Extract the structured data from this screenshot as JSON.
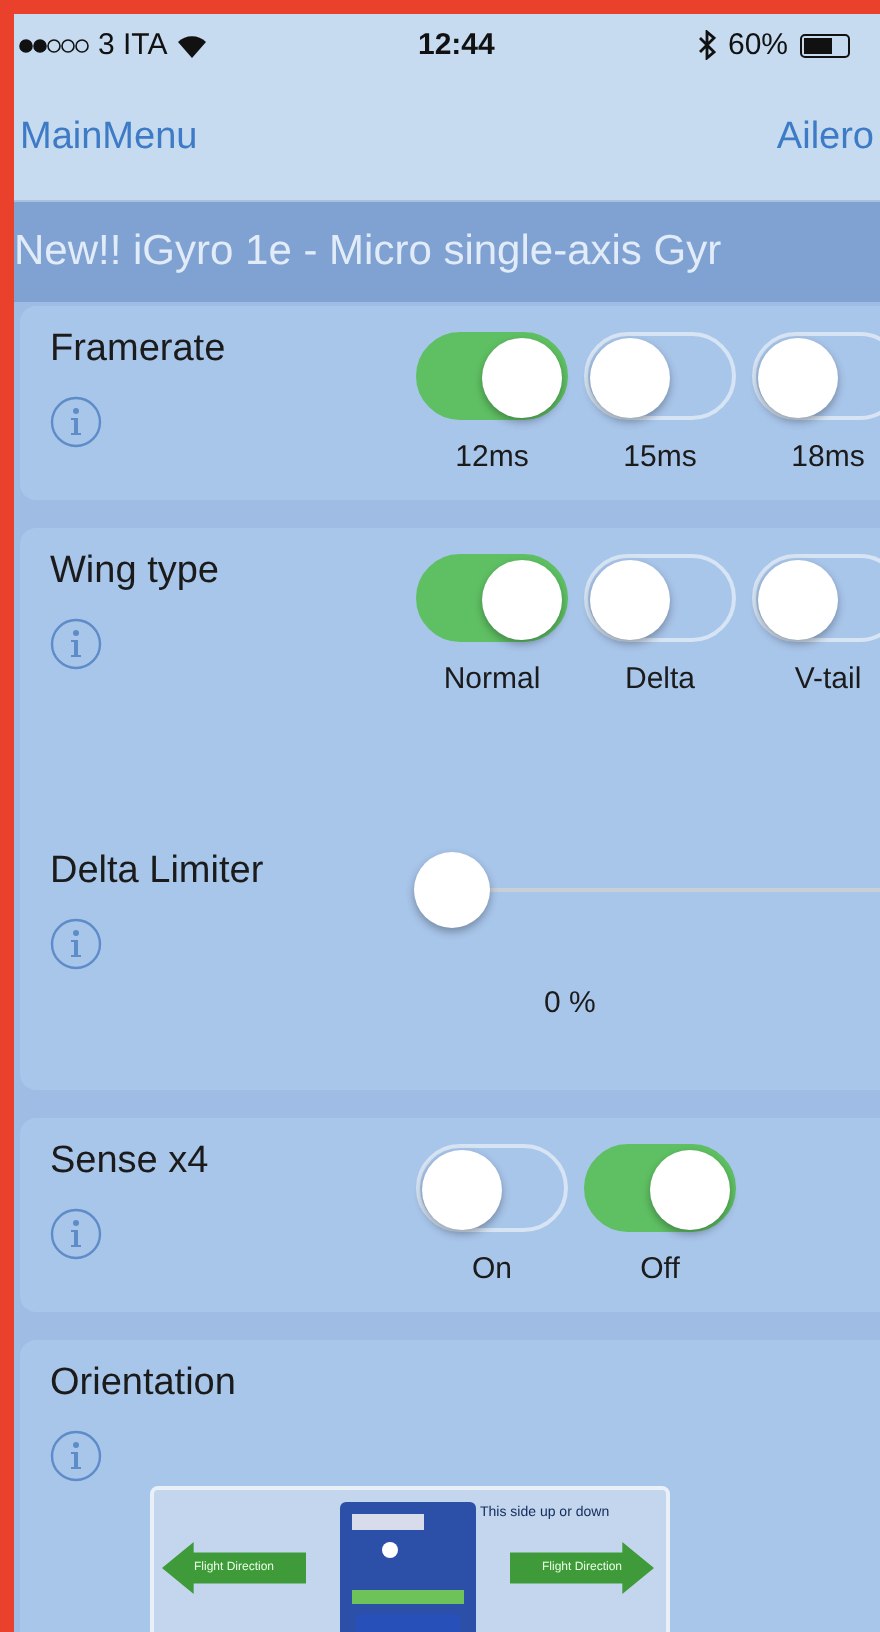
{
  "status_bar": {
    "carrier": "3 ITA",
    "time": "12:44",
    "battery": "60%"
  },
  "nav": {
    "back": "MainMenu",
    "title": "Ailero"
  },
  "banner": "New!! iGyro 1e - Micro single-axis Gyr",
  "cards": [
    {
      "rows": [
        {
          "kind": "toggles",
          "label": "Framerate",
          "options": [
            {
              "label": "12ms",
              "selected": true
            },
            {
              "label": "15ms",
              "selected": false
            },
            {
              "label": "18ms",
              "selected": false
            }
          ]
        }
      ]
    },
    {
      "rows": [
        {
          "kind": "toggles",
          "label": "Wing type",
          "options": [
            {
              "label": "Normal",
              "selected": true
            },
            {
              "label": "Delta",
              "selected": false
            },
            {
              "label": "V-tail",
              "selected": false
            }
          ]
        },
        {
          "kind": "slider",
          "label": "Delta Limiter",
          "level": 0,
          "reading": "0 %"
        }
      ]
    },
    {
      "rows": [
        {
          "kind": "toggles",
          "label": "Sense x4",
          "options": [
            {
              "label": "On",
              "selected": false
            },
            {
              "label": "Off",
              "selected": true
            }
          ]
        }
      ]
    },
    {
      "rows": [
        {
          "kind": "image",
          "label": "Orientation",
          "diagram": {
            "note": "This side up or down",
            "left_arrow": "Flight Direction",
            "right_arrow": "Flight Direction"
          }
        }
      ]
    }
  ]
}
